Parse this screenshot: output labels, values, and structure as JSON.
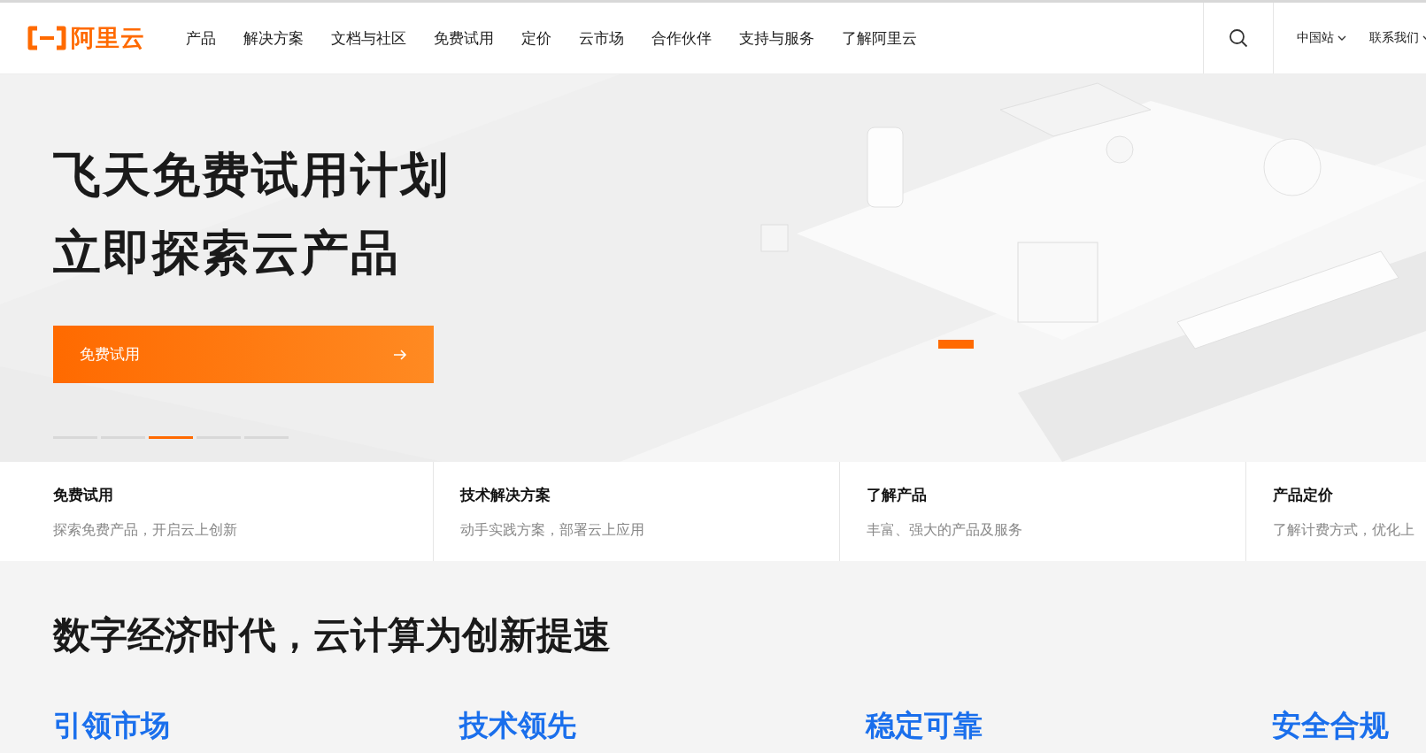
{
  "nav": {
    "logo": "阿里云",
    "items": [
      "产品",
      "解决方案",
      "文档与社区",
      "免费试用",
      "定价",
      "云市场",
      "合作伙伴",
      "支持与服务",
      "了解阿里云"
    ],
    "site": "中国站",
    "contact": "联系我们"
  },
  "hero": {
    "kind": "picture",
    "title_lines": [
      "飞天免费试用计划",
      "立即探索云产品"
    ],
    "cta": "免费试用",
    "slides": [
      {
        "selected": false
      },
      {
        "selected": false
      },
      {
        "selected": true
      },
      {
        "selected": false
      },
      {
        "selected": false
      }
    ]
  },
  "quick_links": [
    {
      "title": "免费试用",
      "subtitle": "探索免费产品，开启云上创新"
    },
    {
      "title": "技术解决方案",
      "subtitle": "动手实践方案，部署云上应用"
    },
    {
      "title": "了解产品",
      "subtitle": "丰富、强大的产品及服务"
    },
    {
      "title": "产品定价",
      "subtitle": "了解计费方式，优化上"
    }
  ],
  "section": {
    "heading": "数字经济时代，云计算为创新提速",
    "features": [
      "引领市场",
      "技术领先",
      "稳定可靠",
      "安全合规"
    ]
  }
}
